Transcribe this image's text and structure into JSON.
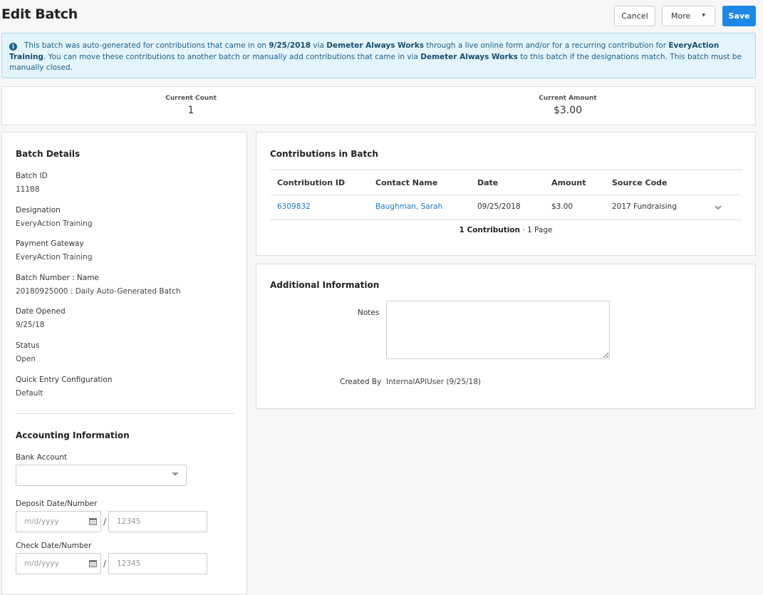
{
  "header": {
    "title": "Edit Batch",
    "cancel_label": "Cancel",
    "more_label": "More",
    "save_label": "Save"
  },
  "alert": {
    "t1": "This batch was auto-generated for contributions that came in on ",
    "date": "9/25/2018",
    "t2": " via ",
    "gateway": "Demeter Always Works",
    "t3": " through a live online form and/or for a recurring contribution for ",
    "designation": "EveryAction Training",
    "t4": ". You can move these contributions to another batch or manually add contributions that came in via ",
    "gateway2": "Demeter Always Works",
    "t5": " to this batch if the designations match. This batch must be manually closed."
  },
  "summary": {
    "count_label": "Current Count",
    "count_value": "1",
    "amount_label": "Current Amount",
    "amount_value": "$3.00"
  },
  "batch_details": {
    "title": "Batch Details",
    "fields": [
      {
        "label": "Batch ID",
        "value": "11188"
      },
      {
        "label": "Designation",
        "value": "EveryAction Training"
      },
      {
        "label": "Payment Gateway",
        "value": "EveryAction Training"
      },
      {
        "label": "Batch Number : Name",
        "value": "20180925000 : Daily Auto-Generated Batch"
      },
      {
        "label": "Date Opened",
        "value": "9/25/18"
      },
      {
        "label": "Status",
        "value": "Open"
      },
      {
        "label": "Quick Entry Configuration",
        "value": "Default"
      }
    ]
  },
  "accounting": {
    "title": "Accounting Information",
    "bank_account_label": "Bank Account",
    "bank_account_value": "",
    "deposit_label": "Deposit Date/Number",
    "deposit_date_placeholder": "m/d/yyyy",
    "deposit_number_placeholder": "12345",
    "check_label": "Check Date/Number",
    "check_date_placeholder": "m/d/yyyy",
    "check_number_placeholder": "12345",
    "separator": "/"
  },
  "contributions": {
    "title": "Contributions in Batch",
    "columns": [
      "Contribution ID",
      "Contact Name",
      "Date",
      "Amount",
      "Source Code"
    ],
    "rows": [
      {
        "id": "6309832",
        "contact": "Baughman, Sarah",
        "date": "09/25/2018",
        "amount": "$3.00",
        "source": "2017 Fundraising"
      }
    ],
    "footer_count": "1 Contribution",
    "footer_pages": " · 1 Page"
  },
  "additional": {
    "title": "Additional Information",
    "notes_label": "Notes",
    "notes_value": "",
    "created_by_label": "Created By",
    "created_by_value": "InternalAPIUser (9/25/18)"
  },
  "colors": {
    "primary": "#1e87e5",
    "link": "#1f76c7",
    "alert_bg": "#e3f4fb",
    "alert_text": "#1f5f88"
  }
}
